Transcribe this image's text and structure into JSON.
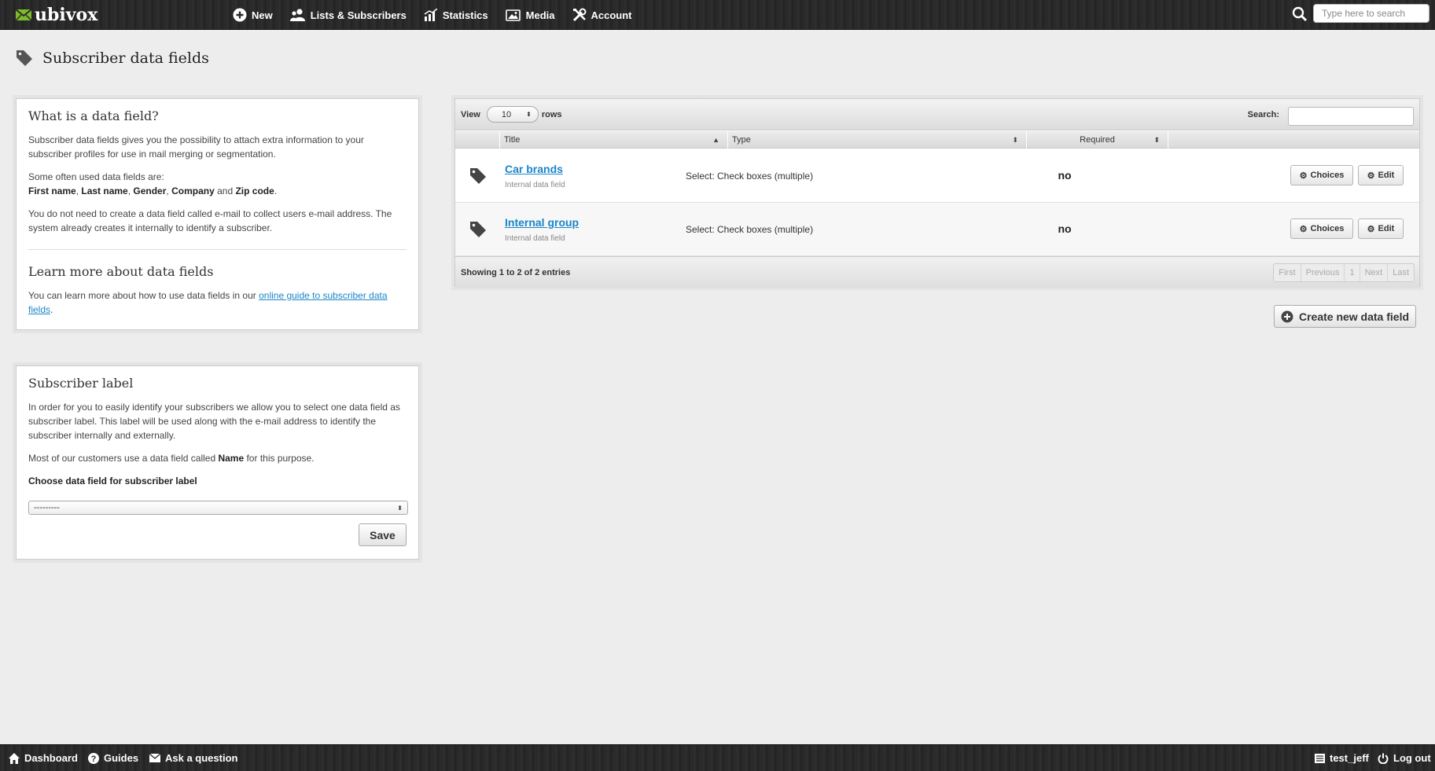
{
  "topbar": {
    "logo": "ubivox",
    "nav": [
      {
        "label": "New",
        "icon": "plus-circle-icon"
      },
      {
        "label": "Lists & Subscribers",
        "icon": "users-icon"
      },
      {
        "label": "Statistics",
        "icon": "chart-icon"
      },
      {
        "label": "Media",
        "icon": "media-icon"
      },
      {
        "label": "Account",
        "icon": "tools-icon"
      }
    ],
    "search_placeholder": "Type here to search"
  },
  "page_title": "Subscriber data fields",
  "info_panel": {
    "heading": "What is a data field?",
    "p1": "Subscriber data fields gives you the possibility to attach extra information to your subscriber profiles for use in mail merging or segmentation.",
    "p2_intro": "Some often used data fields are:",
    "fields": [
      "First name",
      "Last name",
      "Gender",
      "Company",
      "Zip code"
    ],
    "p2_sep_comma": ", ",
    "p2_sep_and": " and ",
    "p2_end": ".",
    "p3": "You do not need to create a data field called e-mail to collect users e-mail address. The system already creates it internally to identify a subscriber.",
    "learn_heading": "Learn more about data fields",
    "learn_text": "You can learn more about how to use data fields in our ",
    "learn_link": "online guide to subscriber data fields",
    "learn_end": "."
  },
  "label_panel": {
    "heading": "Subscriber label",
    "p1": "In order for you to easily identify your subscribers we allow you to select one data field as subscriber label. This label will be used along with the e-mail address to identify the subscriber internally and externally.",
    "p2_before": "Most of our customers use a data field called ",
    "p2_bold": "Name",
    "p2_after": " for this purpose.",
    "choose_label": "Choose data field for subscriber label",
    "select_value": "---------",
    "save": "Save"
  },
  "table": {
    "view_label": "View",
    "rows_value": "10",
    "rows_label": "rows",
    "search_label": "Search:",
    "columns": [
      "Title",
      "Type",
      "Required"
    ],
    "rows": [
      {
        "title": "Car brands",
        "subtitle": "Internal data field",
        "type": "Select: Check boxes (multiple)",
        "required": "no"
      },
      {
        "title": "Internal group",
        "subtitle": "Internal data field",
        "type": "Select: Check boxes (multiple)",
        "required": "no"
      }
    ],
    "choices_label": "Choices",
    "edit_label": "Edit",
    "info": "Showing 1 to 2 of 2 entries",
    "pager": [
      "First",
      "Previous",
      "1",
      "Next",
      "Last"
    ]
  },
  "create_button": "Create new data field",
  "footer": {
    "left": [
      {
        "label": "Dashboard",
        "icon": "home-icon"
      },
      {
        "label": "Guides",
        "icon": "help-icon"
      },
      {
        "label": "Ask a question",
        "icon": "mail-icon"
      }
    ],
    "user": "test_jeff",
    "logout": "Log out"
  }
}
